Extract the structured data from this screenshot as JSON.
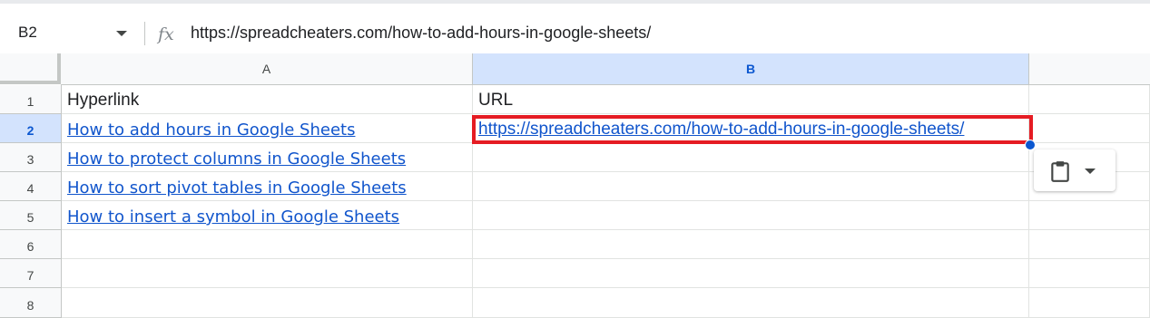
{
  "formula_bar": {
    "name_box": "B2",
    "fx_label": "fx",
    "formula": "https://spreadcheaters.com/how-to-add-hours-in-google-sheets/"
  },
  "columns": [
    "A",
    "B"
  ],
  "rows": [
    "1",
    "2",
    "3",
    "4",
    "5",
    "6",
    "7",
    "8"
  ],
  "cells": {
    "A1": "Hyperlink",
    "B1": "URL",
    "A2": "How to add hours in Google Sheets",
    "B2": "https://spreadcheaters.com/how-to-add-hours-in-google-sheets/",
    "A3": "How to protect columns in Google Sheets",
    "A4": "How to sort pivot tables in Google Sheets",
    "A5": "How to insert a symbol in Google Sheets"
  },
  "selected_cell": "B2",
  "colors": {
    "link": "#1155cc",
    "highlight": "#e51c23",
    "selection_header": "#d3e3fd"
  },
  "icons": {
    "formula": "fx-icon",
    "paste": "clipboard-icon",
    "dropdown": "chevron-down-icon"
  }
}
